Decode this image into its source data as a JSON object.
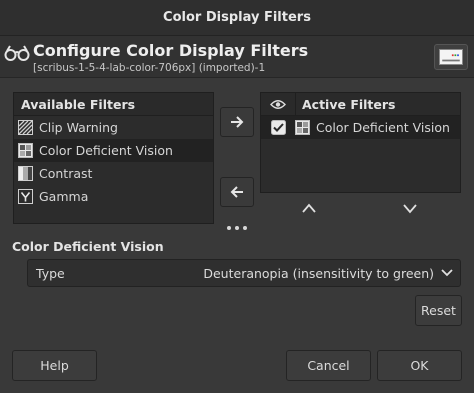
{
  "window": {
    "title": "Color Display Filters"
  },
  "header": {
    "title": "Configure Color Display Filters",
    "subtitle": "[scribus-1-5-4-lab-color-706px] (imported)-1",
    "glasses_icon": "glasses-icon",
    "preview_icon": "color-preview-icon"
  },
  "available": {
    "heading": "Available Filters",
    "items": [
      {
        "label": "Clip Warning",
        "icon": "clip-warning-icon",
        "selected": false
      },
      {
        "label": "Color Deficient Vision",
        "icon": "color-deficient-icon",
        "selected": true
      },
      {
        "label": "Contrast",
        "icon": "contrast-icon",
        "selected": false
      },
      {
        "label": "Gamma",
        "icon": "gamma-icon",
        "selected": false
      }
    ]
  },
  "active": {
    "heading": "Active Filters",
    "eye_icon": "eye-icon",
    "items": [
      {
        "label": "Color Deficient Vision",
        "icon": "color-deficient-icon",
        "checked": true
      }
    ]
  },
  "section": {
    "title": "Color Deficient Vision",
    "type_label": "Type",
    "type_value": "Deuteranopia (insensitivity to green)"
  },
  "buttons": {
    "reset": "Reset",
    "help": "Help",
    "cancel": "Cancel",
    "ok": "OK"
  },
  "colors": {
    "background": "#393939",
    "panel": "#2c2c2c",
    "selected_row": "#222222"
  }
}
